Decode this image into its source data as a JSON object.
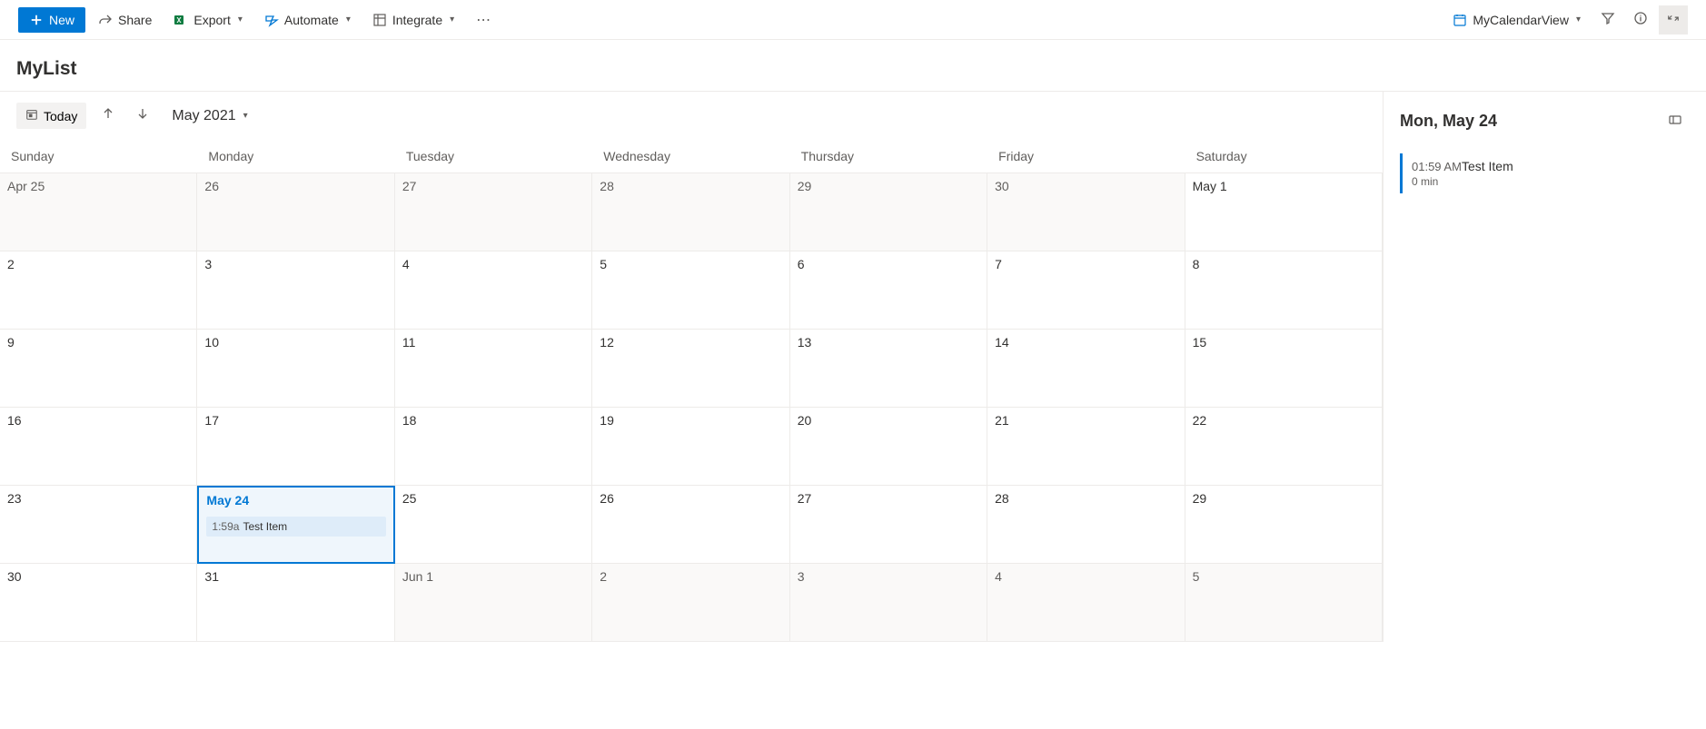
{
  "toolbar": {
    "new": "New",
    "share": "Share",
    "export": "Export",
    "automate": "Automate",
    "integrate": "Integrate",
    "view_name": "MyCalendarView"
  },
  "list_title": "MyList",
  "calendar": {
    "today_label": "Today",
    "month_label": "May 2021",
    "day_headers": [
      "Sunday",
      "Monday",
      "Tuesday",
      "Wednesday",
      "Thursday",
      "Friday",
      "Saturday"
    ],
    "weeks": [
      [
        {
          "label": "Apr 25",
          "out": true
        },
        {
          "label": "26",
          "out": true
        },
        {
          "label": "27",
          "out": true
        },
        {
          "label": "28",
          "out": true
        },
        {
          "label": "29",
          "out": true
        },
        {
          "label": "30",
          "out": true
        },
        {
          "label": "May 1",
          "out": false
        }
      ],
      [
        {
          "label": "2"
        },
        {
          "label": "3"
        },
        {
          "label": "4"
        },
        {
          "label": "5"
        },
        {
          "label": "6"
        },
        {
          "label": "7"
        },
        {
          "label": "8"
        }
      ],
      [
        {
          "label": "9"
        },
        {
          "label": "10"
        },
        {
          "label": "11"
        },
        {
          "label": "12"
        },
        {
          "label": "13"
        },
        {
          "label": "14"
        },
        {
          "label": "15"
        }
      ],
      [
        {
          "label": "16"
        },
        {
          "label": "17"
        },
        {
          "label": "18"
        },
        {
          "label": "19"
        },
        {
          "label": "20"
        },
        {
          "label": "21"
        },
        {
          "label": "22"
        }
      ],
      [
        {
          "label": "23"
        },
        {
          "label": "May 24",
          "selected": true,
          "event": {
            "time": "1:59a",
            "title": "Test Item"
          }
        },
        {
          "label": "25"
        },
        {
          "label": "26"
        },
        {
          "label": "27"
        },
        {
          "label": "28"
        },
        {
          "label": "29"
        }
      ],
      [
        {
          "label": "30"
        },
        {
          "label": "31"
        },
        {
          "label": "Jun 1",
          "out": true
        },
        {
          "label": "2",
          "out": true
        },
        {
          "label": "3",
          "out": true
        },
        {
          "label": "4",
          "out": true
        },
        {
          "label": "5",
          "out": true
        }
      ]
    ]
  },
  "detail": {
    "date_label": "Mon, May 24",
    "items": [
      {
        "time": "01:59 AM",
        "title": "Test Item",
        "duration": "0 min"
      }
    ]
  }
}
